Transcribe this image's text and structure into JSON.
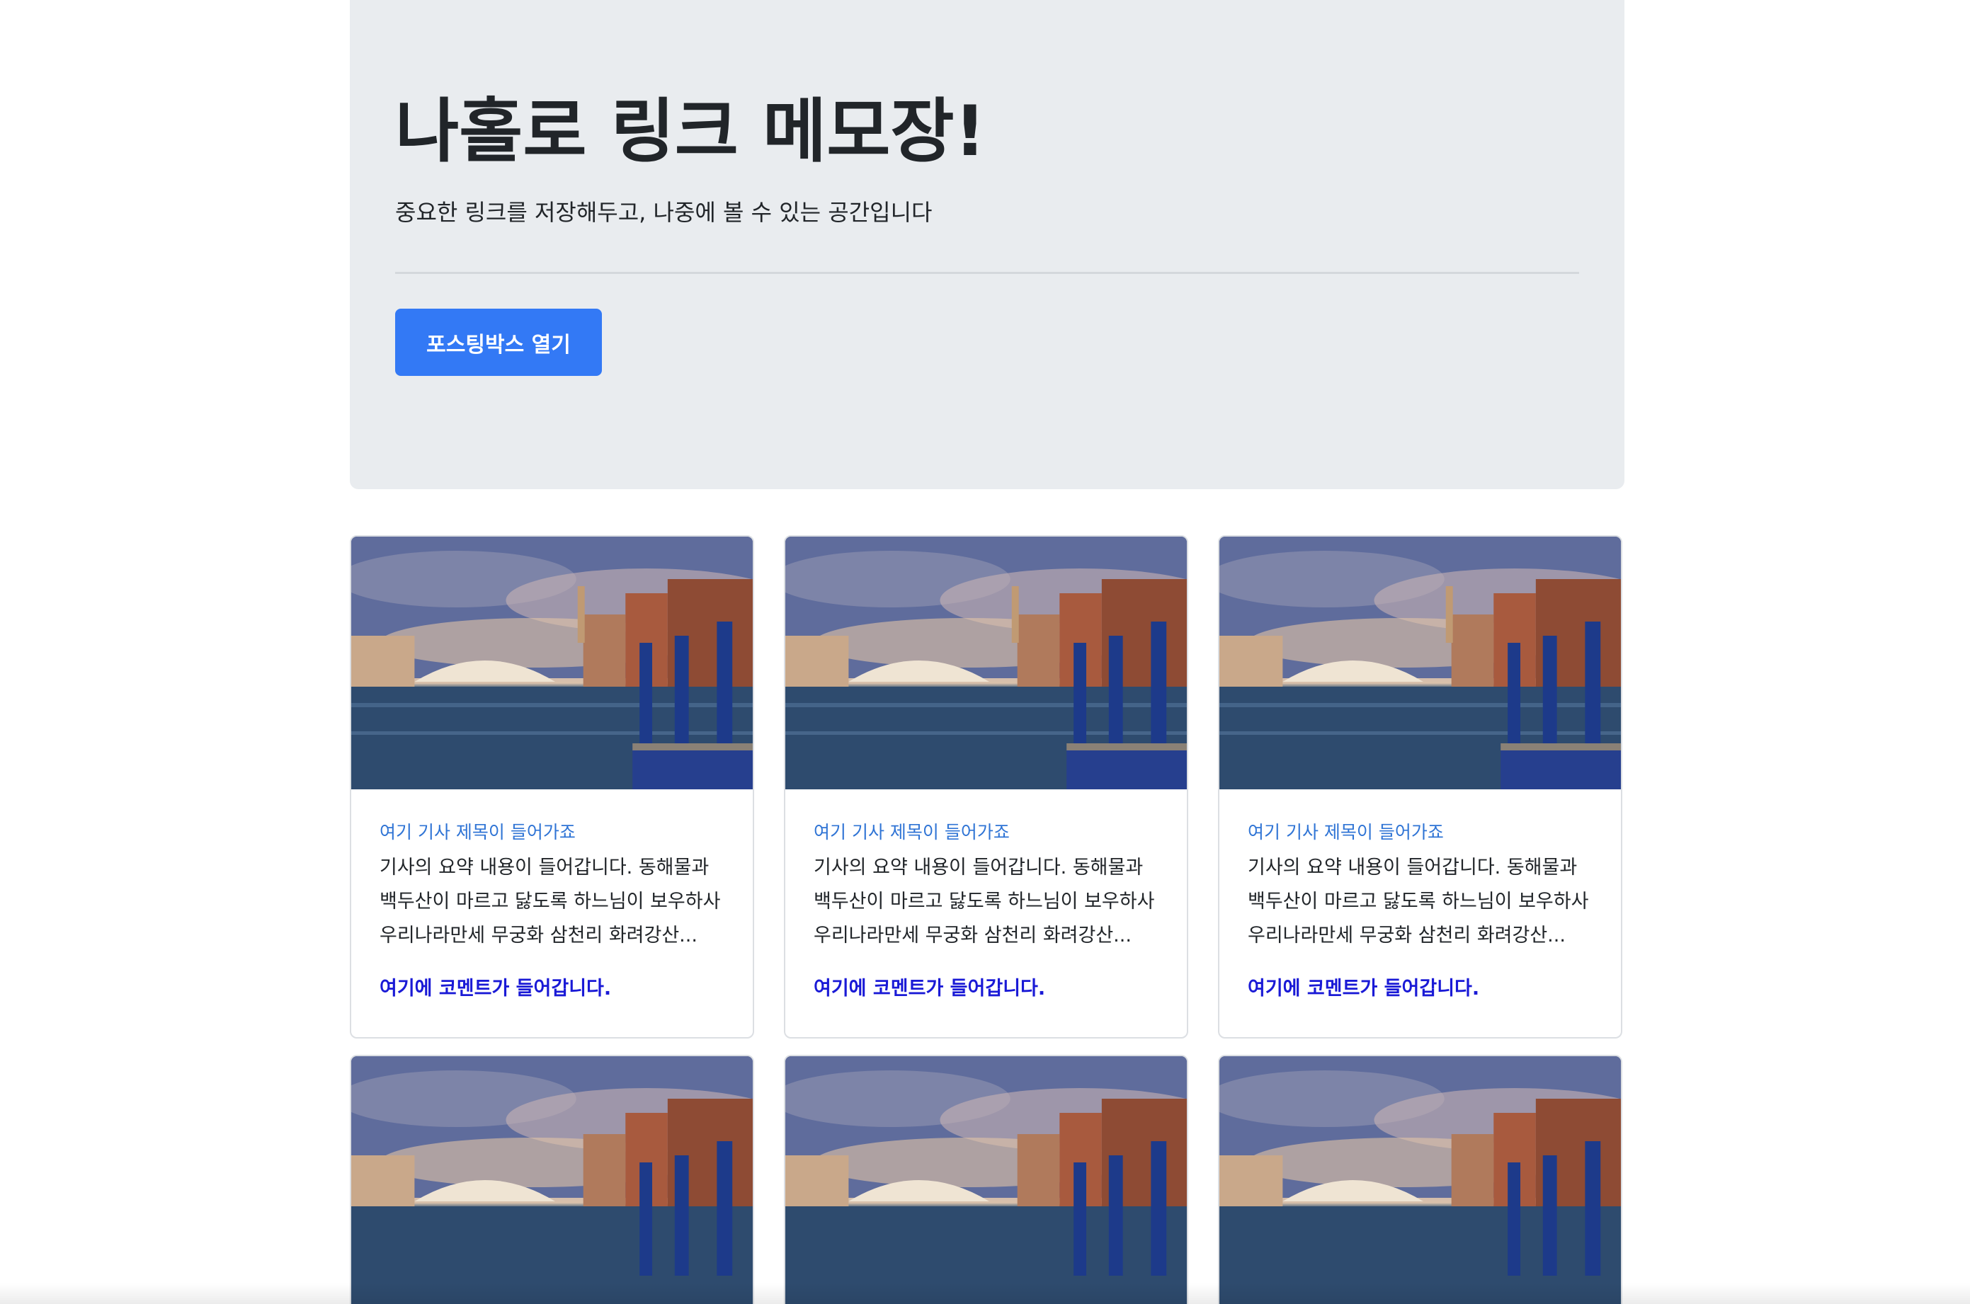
{
  "jumbotron": {
    "title": "나홀로 링크 메모장!",
    "lead": "중요한 링크를 저장해두고, 나중에 볼 수 있는 공간입니다",
    "button_label": "포스팅박스 열기"
  },
  "cards": [
    {
      "title": "여기 기사 제목이 들어가죠",
      "text_lines": [
        "기사의 요약 내용이 들어갑니다. 동해물과",
        "백두산이 마르고 닳도록 하느님이 보우하사",
        "우리나라만세 무궁화 삼천리 화려강산..."
      ],
      "comment": "여기에 코멘트가 들어갑니다."
    },
    {
      "title": "여기 기사 제목이 들어가죠",
      "text_lines": [
        "기사의 요약 내용이 들어갑니다. 동해물과",
        "백두산이 마르고 닳도록 하느님이 보우하사",
        "우리나라만세 무궁화 삼천리 화려강산..."
      ],
      "comment": "여기에 코멘트가 들어갑니다."
    },
    {
      "title": "여기 기사 제목이 들어가죠",
      "text_lines": [
        "기사의 요약 내용이 들어갑니다. 동해물과",
        "백두산이 마르고 닳도록 하느님이 보우하사",
        "우리나라만세 무궁화 삼천리 화려강산..."
      ],
      "comment": "여기에 코멘트가 들어갑니다."
    }
  ],
  "colors": {
    "jumbotron_bg": "#e9ecef",
    "primary_button": "#3379f5",
    "card_title": "#2f74d5",
    "comment": "#1a1ad6"
  }
}
